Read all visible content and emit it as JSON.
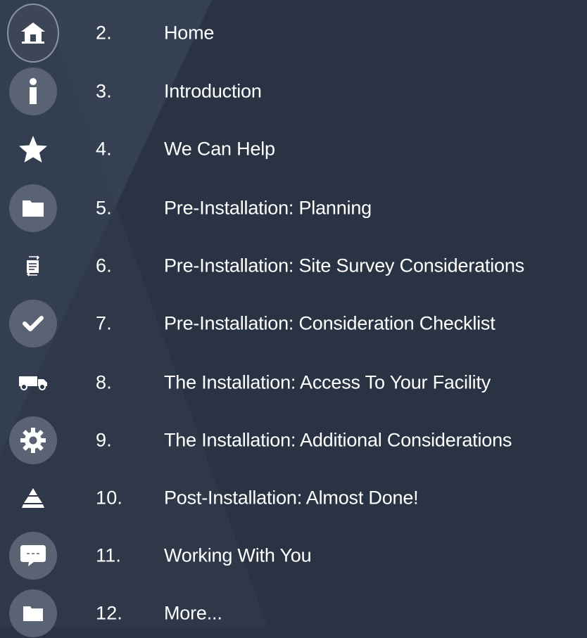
{
  "menu": {
    "items": [
      {
        "number": "2.",
        "label": "Home",
        "icon": "home-icon"
      },
      {
        "number": "3.",
        "label": "Introduction",
        "icon": "info-icon"
      },
      {
        "number": "4.",
        "label": "We Can Help",
        "icon": "star-icon"
      },
      {
        "number": "5.",
        "label": "Pre-Installation: Planning",
        "icon": "folder-icon"
      },
      {
        "number": "6.",
        "label": "Pre-Installation: Site Survey Considerations",
        "icon": "document-sync-icon"
      },
      {
        "number": "7.",
        "label": "Pre-Installation: Consideration Checklist",
        "icon": "checkmark-icon"
      },
      {
        "number": "8.",
        "label": "The Installation: Access To Your Facility",
        "icon": "truck-icon"
      },
      {
        "number": "9.",
        "label": "The Installation: Additional Considerations",
        "icon": "gear-icon"
      },
      {
        "number": "10.",
        "label": "Post-Installation: Almost Done!",
        "icon": "pyramid-icon"
      },
      {
        "number": "11.",
        "label": "Working With You",
        "icon": "chat-bubble-icon"
      },
      {
        "number": "12.",
        "label": "More...",
        "icon": "folder-icon"
      }
    ],
    "active_index": 0
  },
  "colors": {
    "background": "#2a3344",
    "icon_circle": "#5a6373",
    "text": "#ffffff"
  }
}
